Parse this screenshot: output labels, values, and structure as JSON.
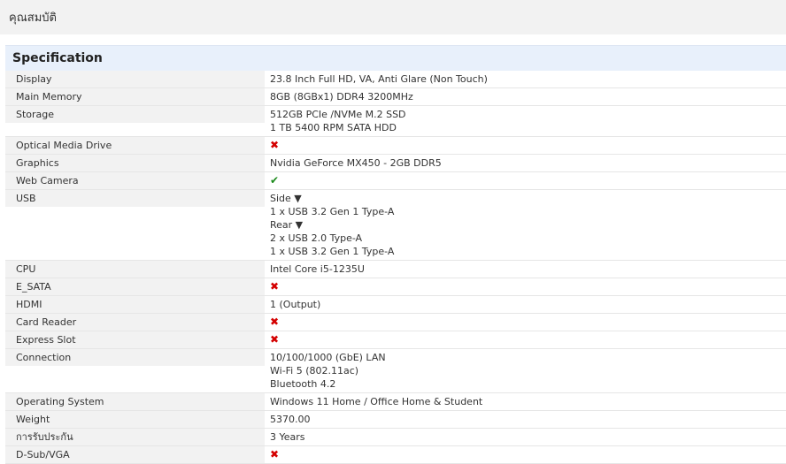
{
  "page": {
    "title": "คุณสมบัติ"
  },
  "section": {
    "title": "Specification"
  },
  "specs": [
    {
      "label": "Display",
      "values": [
        "23.8 Inch Full HD, VA, Anti Glare (Non Touch)"
      ]
    },
    {
      "label": "Main Memory",
      "values": [
        "8GB (8GBx1) DDR4 3200MHz"
      ]
    },
    {
      "label": "Storage",
      "values": [
        "512GB PCIe /NVMe M.2 SSD",
        "1 TB 5400 RPM SATA HDD"
      ]
    },
    {
      "label": "Optical Media Drive",
      "icon": "cross-icon",
      "icon_glyph": "✖"
    },
    {
      "label": "Graphics",
      "values": [
        "Nvidia GeForce MX450 - 2GB DDR5"
      ]
    },
    {
      "label": "Web Camera",
      "icon": "check-icon",
      "icon_glyph": "✔"
    },
    {
      "label": "USB",
      "values": [
        "Side ▼",
        "1 x USB 3.2 Gen 1 Type-A",
        "Rear ▼",
        "2 x USB 2.0 Type-A",
        "1 x USB 3.2 Gen 1 Type-A"
      ]
    },
    {
      "label": "CPU",
      "values": [
        "Intel Core i5-1235U"
      ]
    },
    {
      "label": "E_SATA",
      "icon": "cross-icon",
      "icon_glyph": "✖"
    },
    {
      "label": "HDMI",
      "values": [
        "1 (Output)"
      ]
    },
    {
      "label": "Card Reader",
      "icon": "cross-icon",
      "icon_glyph": "✖"
    },
    {
      "label": "Express Slot",
      "icon": "cross-icon",
      "icon_glyph": "✖"
    },
    {
      "label": "Connection",
      "values": [
        "10/100/1000 (GbE) LAN",
        "Wi-Fi 5 (802.11ac)",
        "Bluetooth 4.2"
      ]
    },
    {
      "label": "Operating System",
      "values": [
        "Windows 11 Home / Office Home & Student"
      ]
    },
    {
      "label": "Weight",
      "values": [
        "5370.00"
      ]
    },
    {
      "label": "การรับประกัน",
      "values": [
        "3 Years"
      ]
    },
    {
      "label": "D-Sub/VGA",
      "icon": "cross-icon",
      "icon_glyph": "✖"
    }
  ],
  "colors": {
    "cross": "#d40000",
    "check": "#1b8a1b",
    "header_bg": "#e8f0fb",
    "label_bg": "#f2f2f2"
  }
}
